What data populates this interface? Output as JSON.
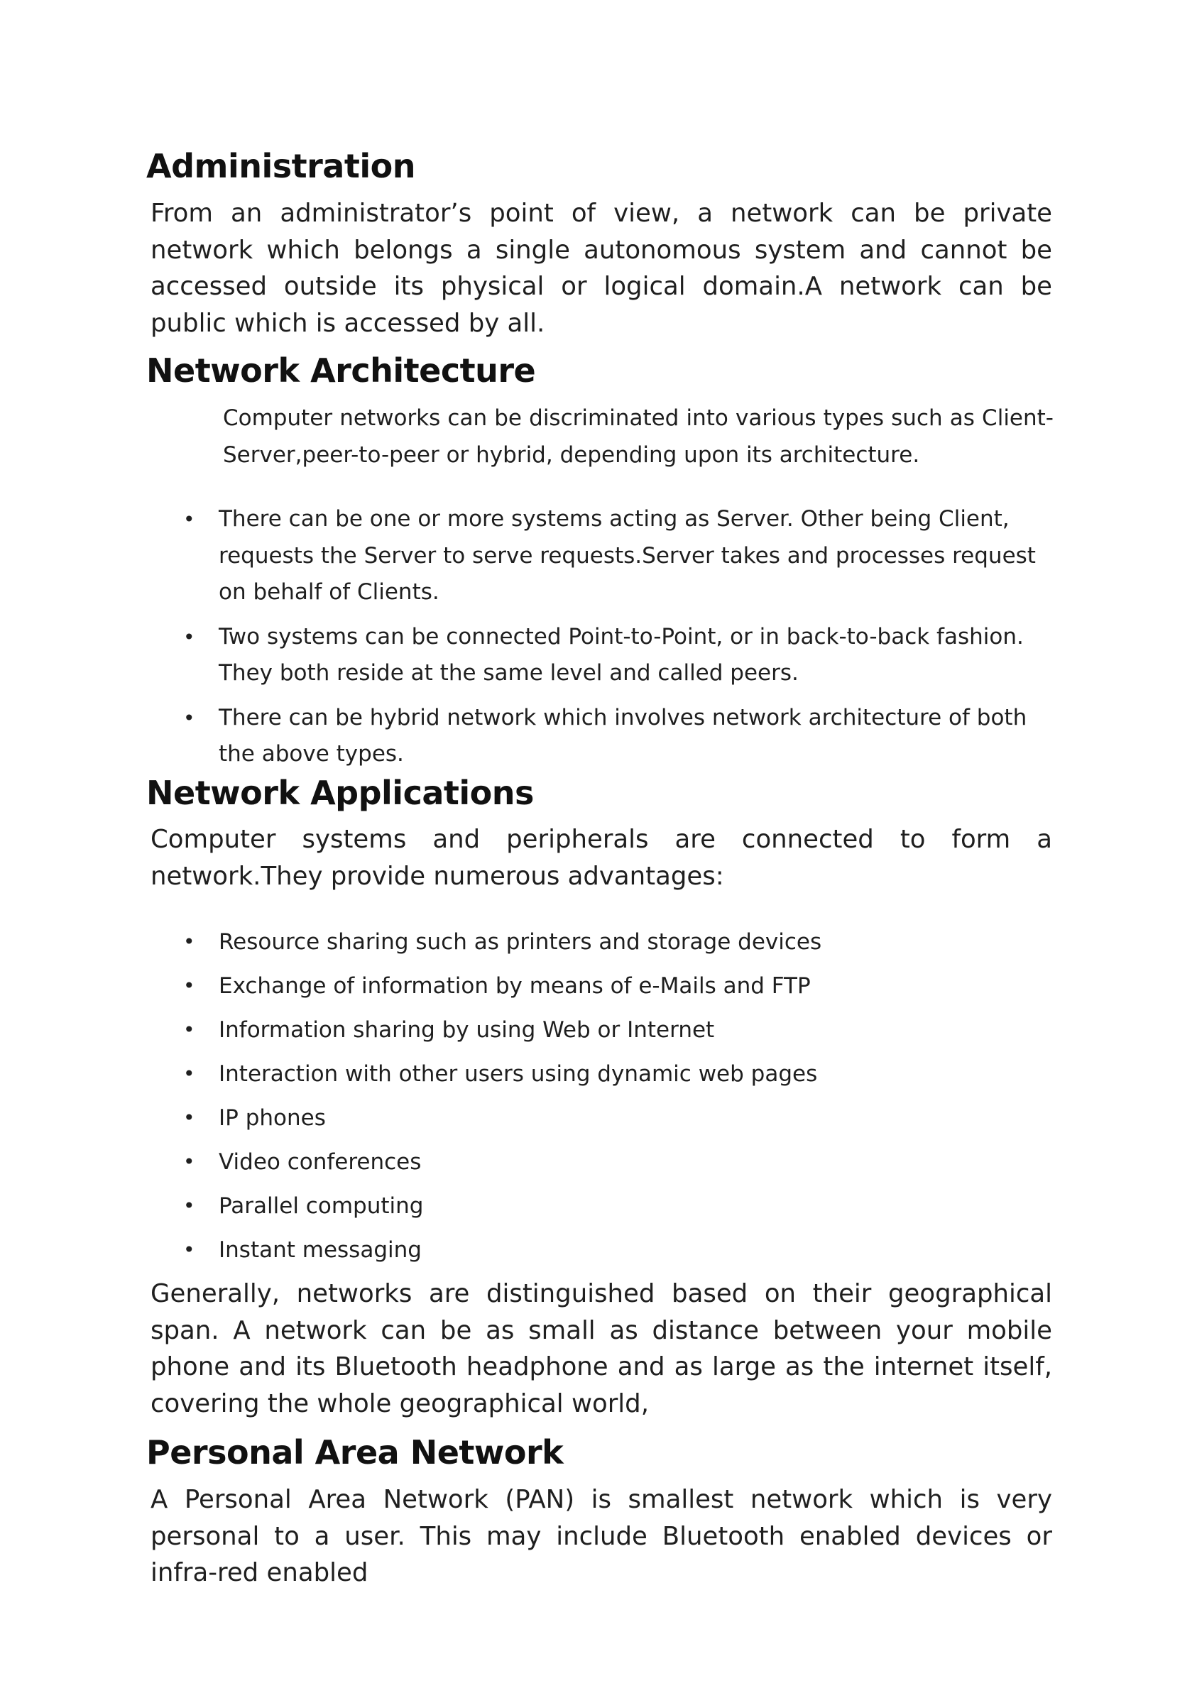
{
  "sections": {
    "administration": {
      "title": "Administration",
      "body": "From an administrator’s point of view, a network can be private network which belongs a single autonomous system and cannot be accessed outside its physical or logical domain.A network can be public which is accessed by all."
    },
    "architecture": {
      "title": "Network Architecture",
      "intro": "Computer networks can be discriminated into various types such as Client-Server,peer-to-peer or hybrid, depending upon its architecture.",
      "bullets": [
        "There can be one or more systems acting as Server. Other being Client, requests the Server to serve requests.Server takes and processes request on behalf of Clients.",
        "Two systems can be connected Point-to-Point, or in back-to-back fashion. They both reside at the same level and called peers.",
        "There can be hybrid network which involves network architecture of both the above types."
      ]
    },
    "applications": {
      "title": "Network Applications",
      "intro": "Computer systems and peripherals are connected to form a network.They provide numerous advantages:",
      "bullets": [
        "Resource sharing such as printers and storage devices",
        "Exchange of information by means of e-Mails and FTP",
        "Information sharing by using Web or Internet",
        "Interaction with other users using dynamic web pages",
        "IP phones",
        "Video conferences",
        "Parallel computing",
        "Instant messaging"
      ],
      "closing": "Generally, networks are distinguished based on their geographical span. A network can be as small as distance between your mobile phone and its Bluetooth headphone and as large as the internet itself, covering the whole geographical world,"
    },
    "pan": {
      "title": "Personal Area Network",
      "body": "A Personal Area Network (PAN) is smallest network which is very personal to a user. This may include Bluetooth enabled devices or infra-red enabled"
    }
  },
  "bullet_glyph": "•"
}
